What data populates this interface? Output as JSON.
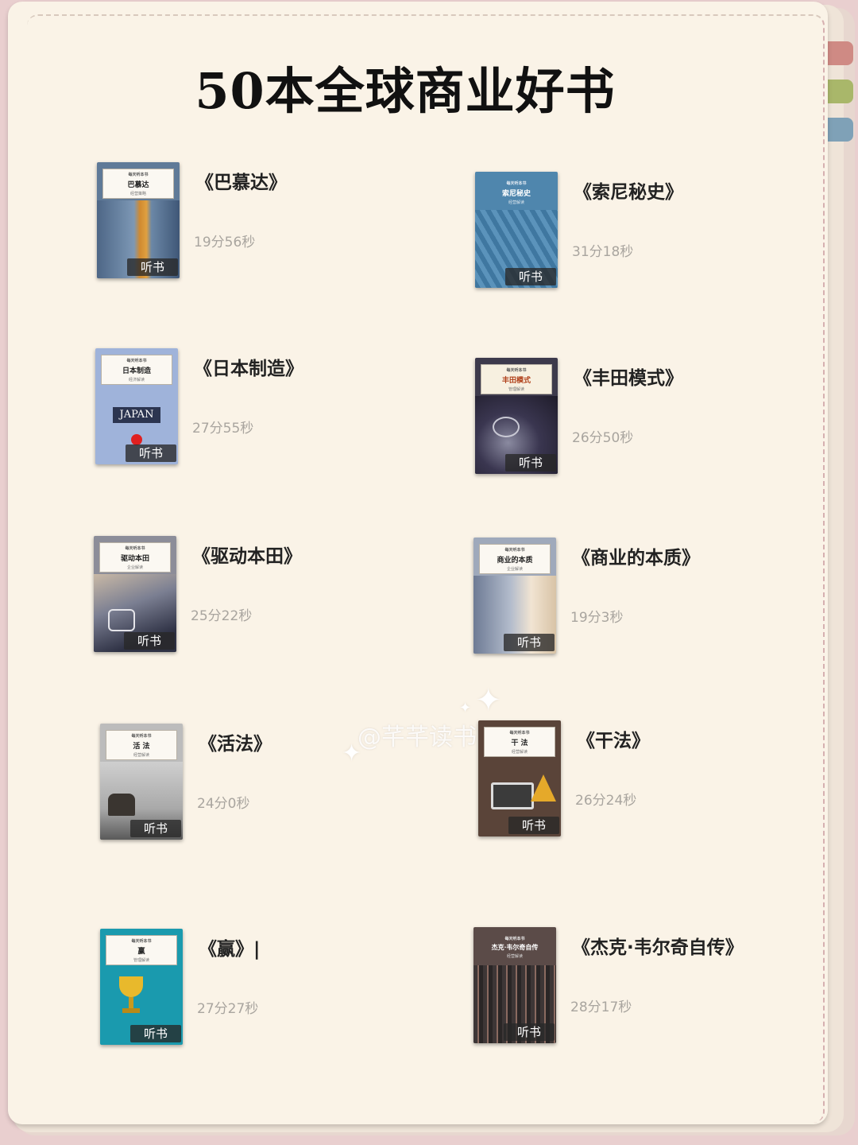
{
  "title": "50本全球商业好书",
  "watermark": "@芊芊读书",
  "cover_badge": "听书",
  "cover_series": "每天听本书",
  "books": [
    {
      "title": "《巴慕达》",
      "duration": "19分56秒",
      "cover_title": "巴慕达",
      "cover_sub": "经营策略",
      "color": "#5f7a98"
    },
    {
      "title": "《索尼秘史》",
      "duration": "31分18秒",
      "cover_title": "索尼秘史",
      "cover_sub": "经营解读",
      "color": "#4f86ad"
    },
    {
      "title": "《日本制造》",
      "duration": "27分55秒",
      "cover_title": "日本制造",
      "cover_sub": "经济解读",
      "color": "#9fb3da",
      "cover_art_text": "JAPAN"
    },
    {
      "title": "《丰田模式》",
      "duration": "26分50秒",
      "cover_title": "丰田模式",
      "cover_sub": "管理解读",
      "color": "#3d3a4c"
    },
    {
      "title": "《驱动本田》",
      "duration": "25分22秒",
      "cover_title": "驱动本田",
      "cover_sub": "企业解读",
      "color": "#8c8d99"
    },
    {
      "title": "《商业的本质》",
      "duration": "19分3秒",
      "cover_title": "商业的本质",
      "cover_sub": "企业解读",
      "color": "#9fa9bb"
    },
    {
      "title": "《活法》",
      "duration": "24分0秒",
      "cover_title": "活 法",
      "cover_sub": "经营解读",
      "color": "#bcbcbc"
    },
    {
      "title": "《干法》",
      "duration": "26分24秒",
      "cover_title": "干 法",
      "cover_sub": "经营解读",
      "color": "#5a4439"
    },
    {
      "title": "《赢》|",
      "duration": "27分27秒",
      "cover_title": "赢",
      "cover_sub": "管理解读",
      "color": "#1a9aae"
    },
    {
      "title": "《杰克·韦尔奇自传》",
      "duration": "28分17秒",
      "cover_title": "杰克·韦尔奇自传",
      "cover_sub": "经营解读",
      "color": "#5b4b48"
    }
  ]
}
